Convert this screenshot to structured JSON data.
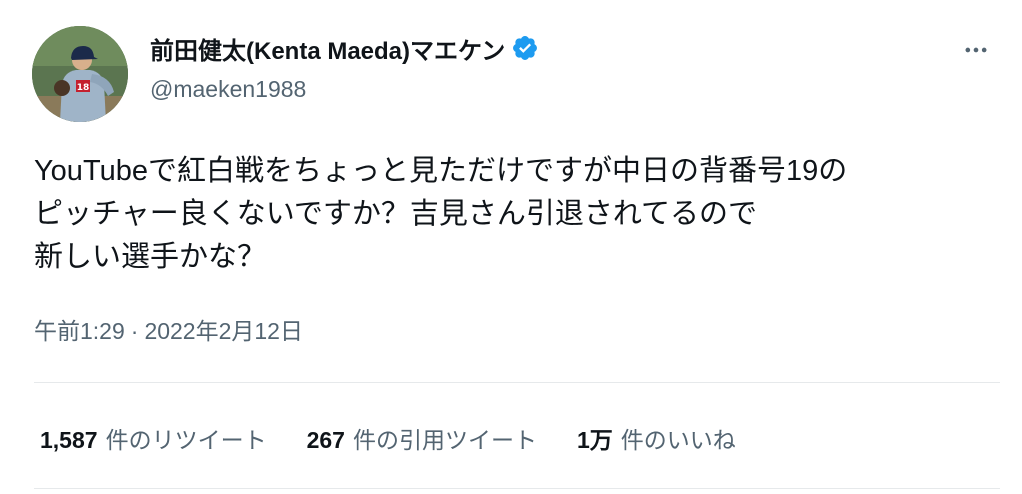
{
  "author": {
    "display_name": "前田健太(Kenta Maeda)マエケン",
    "handle": "@maeken1988",
    "verified": true,
    "avatar_icon": "profile-photo-pitcher",
    "verified_color": "#1d9bf0"
  },
  "menu": {
    "icon": "more-horizontal-icon"
  },
  "tweet": {
    "lines": [
      "YouTubeで紅白戦をちょっと見ただけですが中日の背番号19の",
      "ピッチャー良くないですか？吉見さん引退されてるので",
      "新しい選手かな？"
    ],
    "time": "午前1:29",
    "separator": "·",
    "date": "2022年2月12日"
  },
  "stats": {
    "retweets": {
      "count": "1,587",
      "label": "件のリツイート"
    },
    "quotes": {
      "count": "267",
      "label": "件の引用ツイート"
    },
    "likes": {
      "count": "1万",
      "label": "件のいいね"
    }
  },
  "colors": {
    "text": "#0f1419",
    "secondary": "#536471",
    "divider": "#e6e9eb",
    "accent": "#1d9bf0"
  }
}
